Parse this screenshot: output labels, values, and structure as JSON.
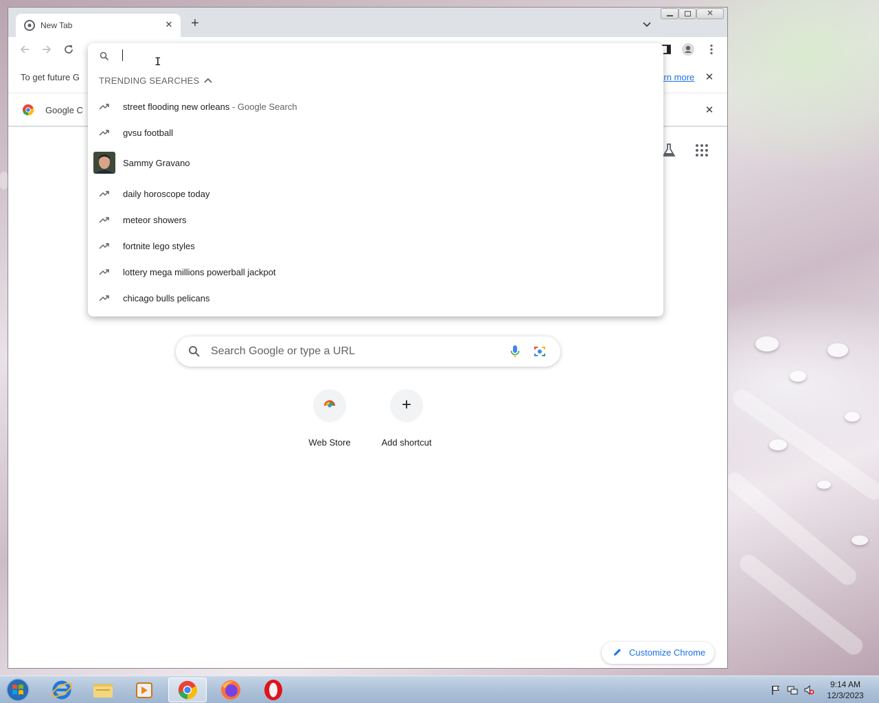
{
  "browser": {
    "tab_title": "New Tab",
    "infobar_text": "To get future G",
    "infobar_link": "earn more",
    "bookmark_label": "Google C"
  },
  "omnibox": {
    "section_header": "TRENDING SEARCHES",
    "suggestions": [
      {
        "text": "street flooding new orleans",
        "suffix": " - Google Search",
        "icon": "trending-icon"
      },
      {
        "text": "gvsu football",
        "icon": "trending-icon"
      },
      {
        "text": "Sammy Gravano",
        "icon": "person-thumbnail"
      },
      {
        "text": "daily horoscope today",
        "icon": "trending-icon"
      },
      {
        "text": "meteor showers",
        "icon": "trending-icon"
      },
      {
        "text": "fortnite lego styles",
        "icon": "trending-icon"
      },
      {
        "text": "lottery mega millions powerball jackpot",
        "icon": "trending-icon"
      },
      {
        "text": "chicago bulls pelicans",
        "icon": "trending-icon"
      }
    ]
  },
  "ntp": {
    "search_placeholder": "Search Google or type a URL",
    "shortcuts": [
      {
        "label": "Web Store"
      },
      {
        "label": "Add shortcut"
      }
    ],
    "customize_label": "Customize Chrome"
  },
  "taskbar": {
    "apps": [
      "internet-explorer",
      "file-explorer",
      "media-player",
      "chrome",
      "firefox",
      "opera"
    ],
    "active_app": "chrome",
    "time": "9:14 AM",
    "date": "12/3/2023"
  },
  "colors": {
    "accent": "#1a73e8",
    "tabstrip": "#dee1e6"
  }
}
